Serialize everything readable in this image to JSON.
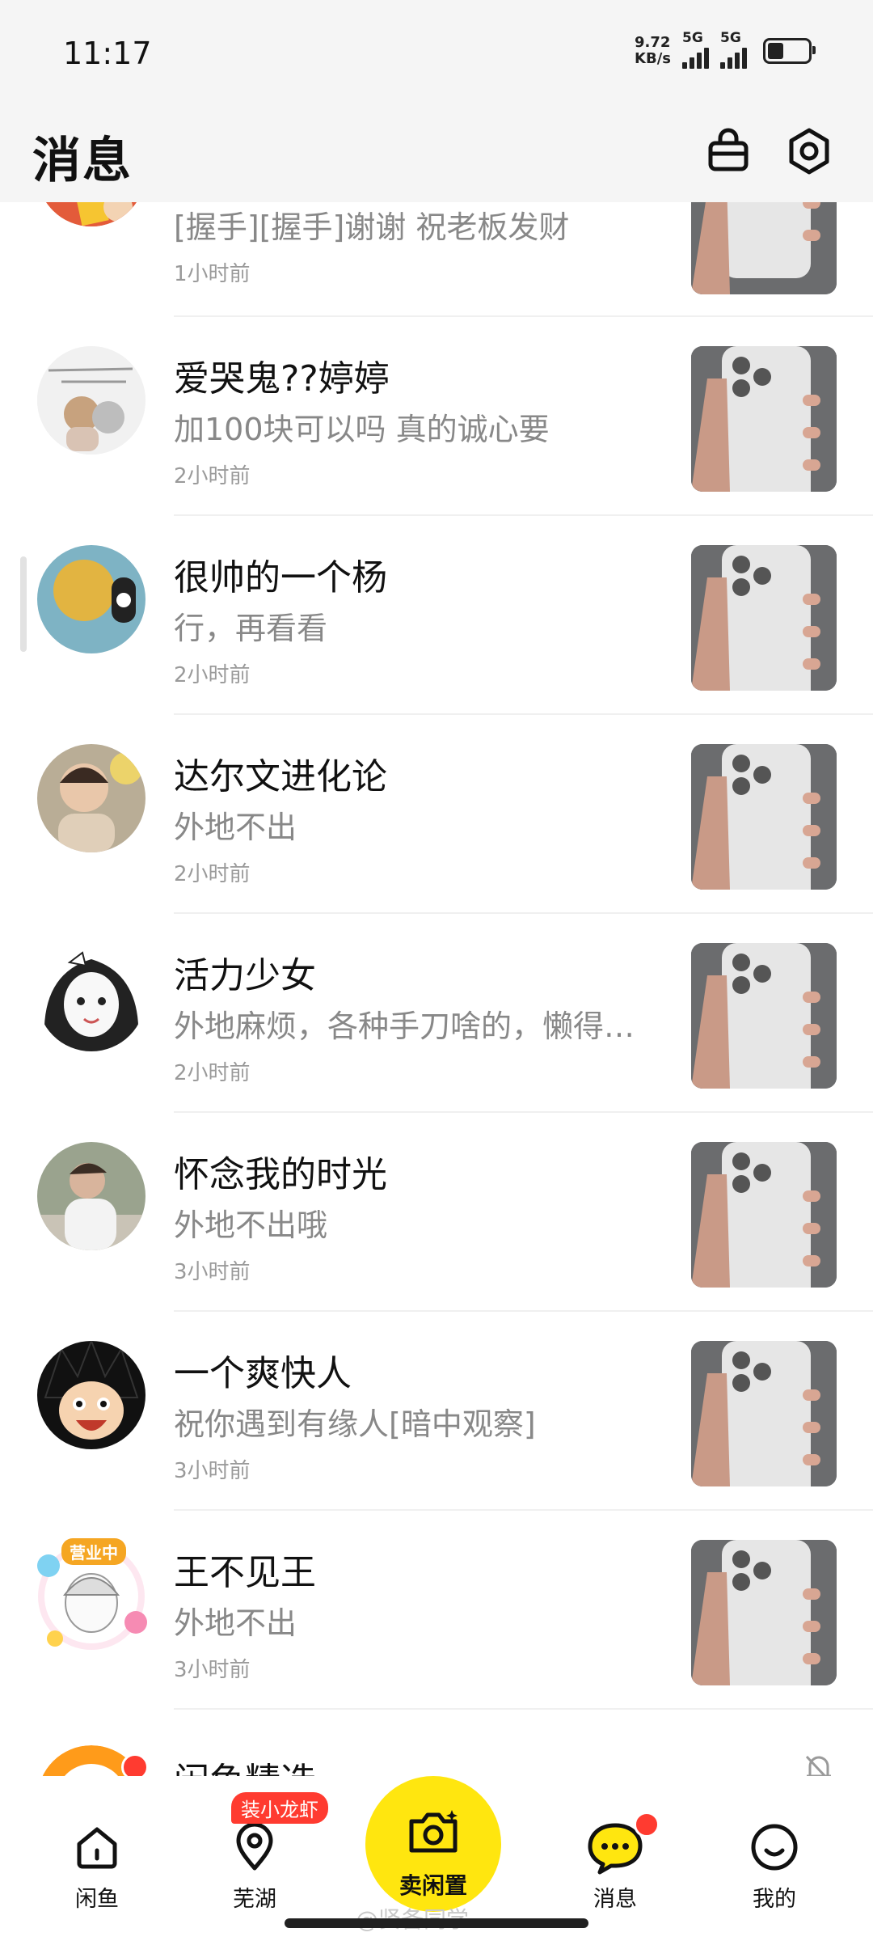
{
  "status_bar": {
    "time": "11:17",
    "net_speed_value": "9.72",
    "net_speed_unit": "KB/s",
    "signal_1_label": "5G",
    "signal_2_label": "5G",
    "battery_level_percent": 40
  },
  "header": {
    "title": "消息",
    "bag_icon": "bag-icon",
    "settings_icon": "settings-icon"
  },
  "conversations": [
    {
      "name": "",
      "message": "[握手][握手]谢谢 祝老板发财",
      "time": "1小时前"
    },
    {
      "name": "爱哭鬼??婷婷",
      "message": "加100块可以吗 真的诚心要",
      "time": "2小时前"
    },
    {
      "name": "很帅的一个杨",
      "message": "行，再看看",
      "time": "2小时前"
    },
    {
      "name": "达尔文进化论",
      "message": "外地不出",
      "time": "2小时前"
    },
    {
      "name": "活力少女",
      "message": "外地麻烦，各种手刀啥的，懒得…",
      "time": "2小时前"
    },
    {
      "name": "怀念我的时光",
      "message": "外地不出哦",
      "time": "3小时前"
    },
    {
      "name": "一个爽快人",
      "message": "祝你遇到有缘人[暗中观察]",
      "time": "3小时前"
    },
    {
      "name": "王不见王",
      "message": "外地不出",
      "time": "3小时前"
    },
    {
      "name": "闲鱼精选",
      "message": "",
      "time": ""
    }
  ],
  "avatar_badge": "营业中",
  "mute_icon": "bell-off-icon",
  "bottom_nav": {
    "home_label": "闲鱼",
    "nearby_label": "芜湖",
    "nearby_badge": "装小龙虾",
    "sell_label": "卖闲置",
    "messages_label": "消息",
    "me_label": "我的"
  },
  "watermark": "@贤备同学",
  "colors": {
    "brand_yellow": "#ffe60f",
    "badge_red": "#ff3b30",
    "top_bar_bg": "#f5f5f5"
  }
}
